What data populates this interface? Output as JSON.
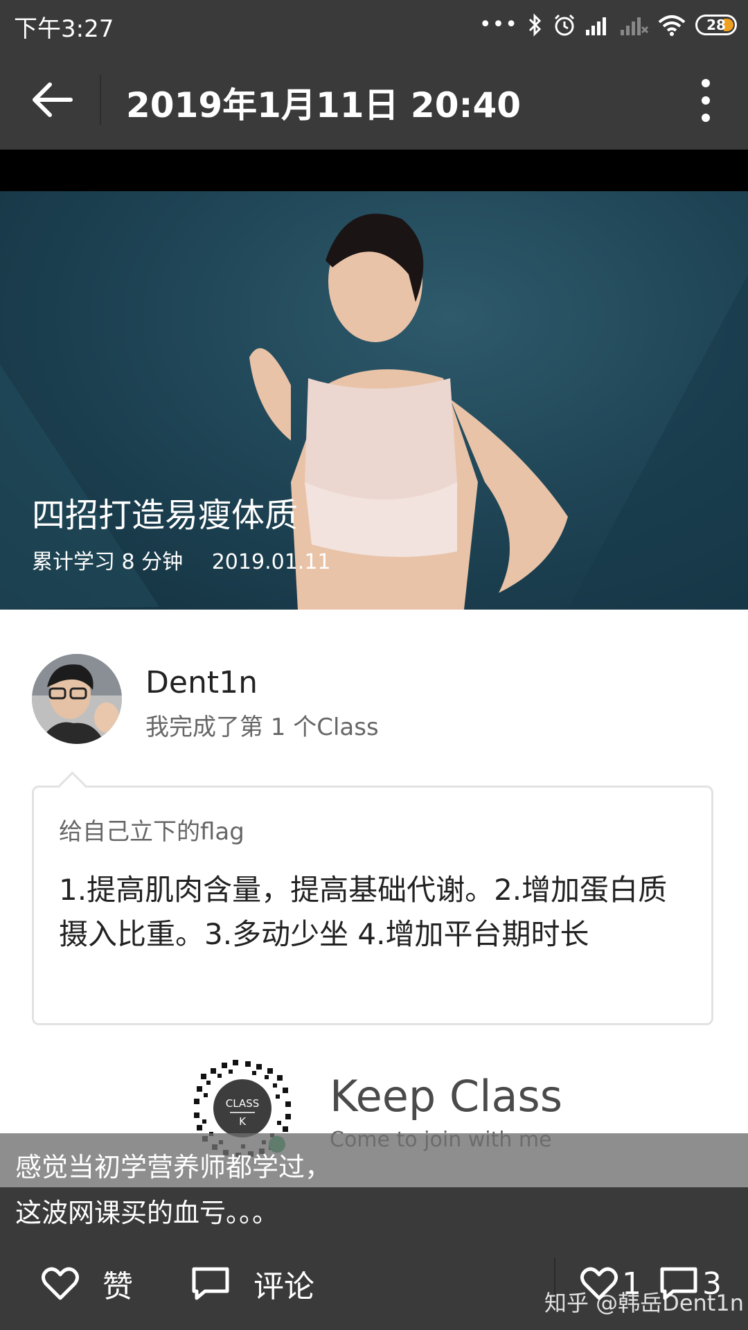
{
  "status_bar": {
    "time": "下午3:27",
    "icons": [
      "more-dots-icon",
      "bluetooth-icon",
      "alarm-icon",
      "signal-icon",
      "signal-disabled-icon",
      "wifi-icon"
    ],
    "battery_level": "28",
    "battery_color": "#f0a020"
  },
  "app_bar": {
    "title": "2019年1月11日 20:40",
    "back_icon": "arrow-left-icon",
    "menu_icon": "more-vertical-icon"
  },
  "course": {
    "title": "四招打造易瘦体质",
    "study_time": "累计学习 8 分钟",
    "date": "2019.01.11"
  },
  "post": {
    "username": "Dent1n",
    "message": "我完成了第 1 个Class"
  },
  "flag": {
    "label": "给自己立下的flag",
    "text": "1.提高肌肉含量，提高基础代谢。2.增加蛋白质摄入比重。3.多动少坐 4.增加平台期时长"
  },
  "brand": {
    "qr_text_top": "CLASS",
    "qr_text_bottom": "K",
    "name": "Keep Class",
    "tagline": "Come to join with me"
  },
  "caption": {
    "line1": "感觉当初学营养师都学过，",
    "line2": "这波网课买的血亏。。。"
  },
  "bottom_bar": {
    "like_label": "赞",
    "comment_label": "评论",
    "like_count": "1",
    "comment_count": "3",
    "watermark": "知乎 @韩岳Dent1n"
  },
  "colors": {
    "bar_background": "#3a3a3a",
    "hero_background": "#1f4556"
  }
}
